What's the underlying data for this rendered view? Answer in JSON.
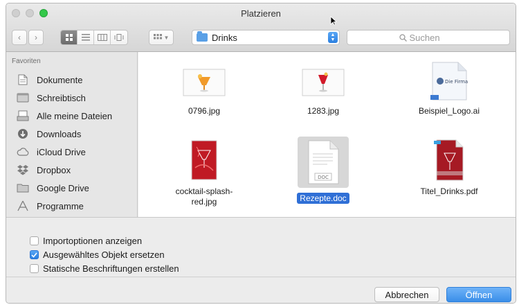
{
  "window": {
    "title": "Platzieren"
  },
  "toolbar": {
    "path_folder": "Drinks",
    "search_placeholder": "Suchen"
  },
  "sidebar": {
    "heading": "Favoriten",
    "items": [
      {
        "label": "Dokumente",
        "icon": "document-icon"
      },
      {
        "label": "Schreibtisch",
        "icon": "desktop-icon"
      },
      {
        "label": "Alle meine Dateien",
        "icon": "all-files-icon"
      },
      {
        "label": "Downloads",
        "icon": "download-icon"
      },
      {
        "label": "iCloud Drive",
        "icon": "cloud-icon"
      },
      {
        "label": "Dropbox",
        "icon": "dropbox-icon"
      },
      {
        "label": "Google Drive",
        "icon": "folder-icon"
      },
      {
        "label": "Programme",
        "icon": "applications-icon"
      }
    ]
  },
  "files": [
    {
      "name": "0796.jpg",
      "kind": "photo-orange-drink"
    },
    {
      "name": "1283.jpg",
      "kind": "photo-red-drink"
    },
    {
      "name": "Beispiel_Logo.ai",
      "kind": "illustrator-file",
      "thumb_text": "Die Firma"
    },
    {
      "name": "cocktail-splash-red.jpg",
      "kind": "photo-red-splash"
    },
    {
      "name": "Rezepte.doc",
      "kind": "word-doc",
      "thumb_text": "DOC",
      "selected": true
    },
    {
      "name": "Titel_Drinks.pdf",
      "kind": "pdf-file"
    }
  ],
  "options": [
    {
      "label": "Importoptionen anzeigen",
      "checked": false
    },
    {
      "label": "Ausgewähltes Objekt ersetzen",
      "checked": true
    },
    {
      "label": "Statische Beschriftungen erstellen",
      "checked": false
    }
  ],
  "buttons": {
    "cancel": "Abbrechen",
    "open": "Öffnen"
  },
  "colors": {
    "accent": "#2f6fd6",
    "zoom_green": "#34c84a",
    "folder_blue": "#5aa0e6"
  }
}
